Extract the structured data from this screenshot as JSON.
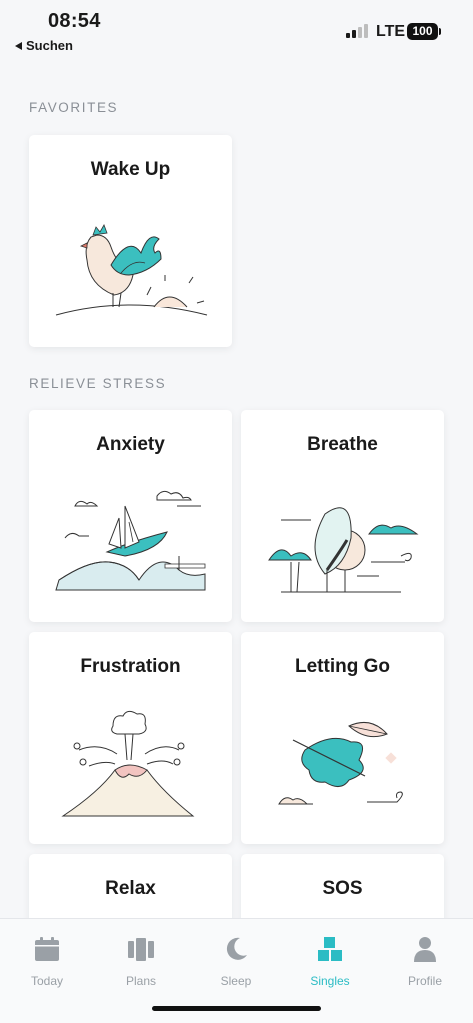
{
  "status": {
    "time": "08:54",
    "back_label": "Suchen",
    "network": "LTE",
    "battery": "100"
  },
  "sections": [
    {
      "title": "FAVORITES"
    },
    {
      "title": "RELIEVE STRESS"
    }
  ],
  "favorites": [
    {
      "title": "Wake Up"
    }
  ],
  "stress": [
    {
      "title": "Anxiety"
    },
    {
      "title": "Breathe"
    },
    {
      "title": "Frustration"
    },
    {
      "title": "Letting Go"
    },
    {
      "title": "Relax"
    },
    {
      "title": "SOS"
    }
  ],
  "tabs": [
    {
      "label": "Today",
      "icon": "calendar-icon"
    },
    {
      "label": "Plans",
      "icon": "cards-icon"
    },
    {
      "label": "Sleep",
      "icon": "moon-icon"
    },
    {
      "label": "Singles",
      "icon": "blocks-icon",
      "active": true
    },
    {
      "label": "Profile",
      "icon": "person-icon"
    }
  ],
  "colors": {
    "accent": "#2bbcc4",
    "teal": "#3bbfbf",
    "inactive": "#9aa0a6",
    "peach": "#f7e8dc"
  }
}
